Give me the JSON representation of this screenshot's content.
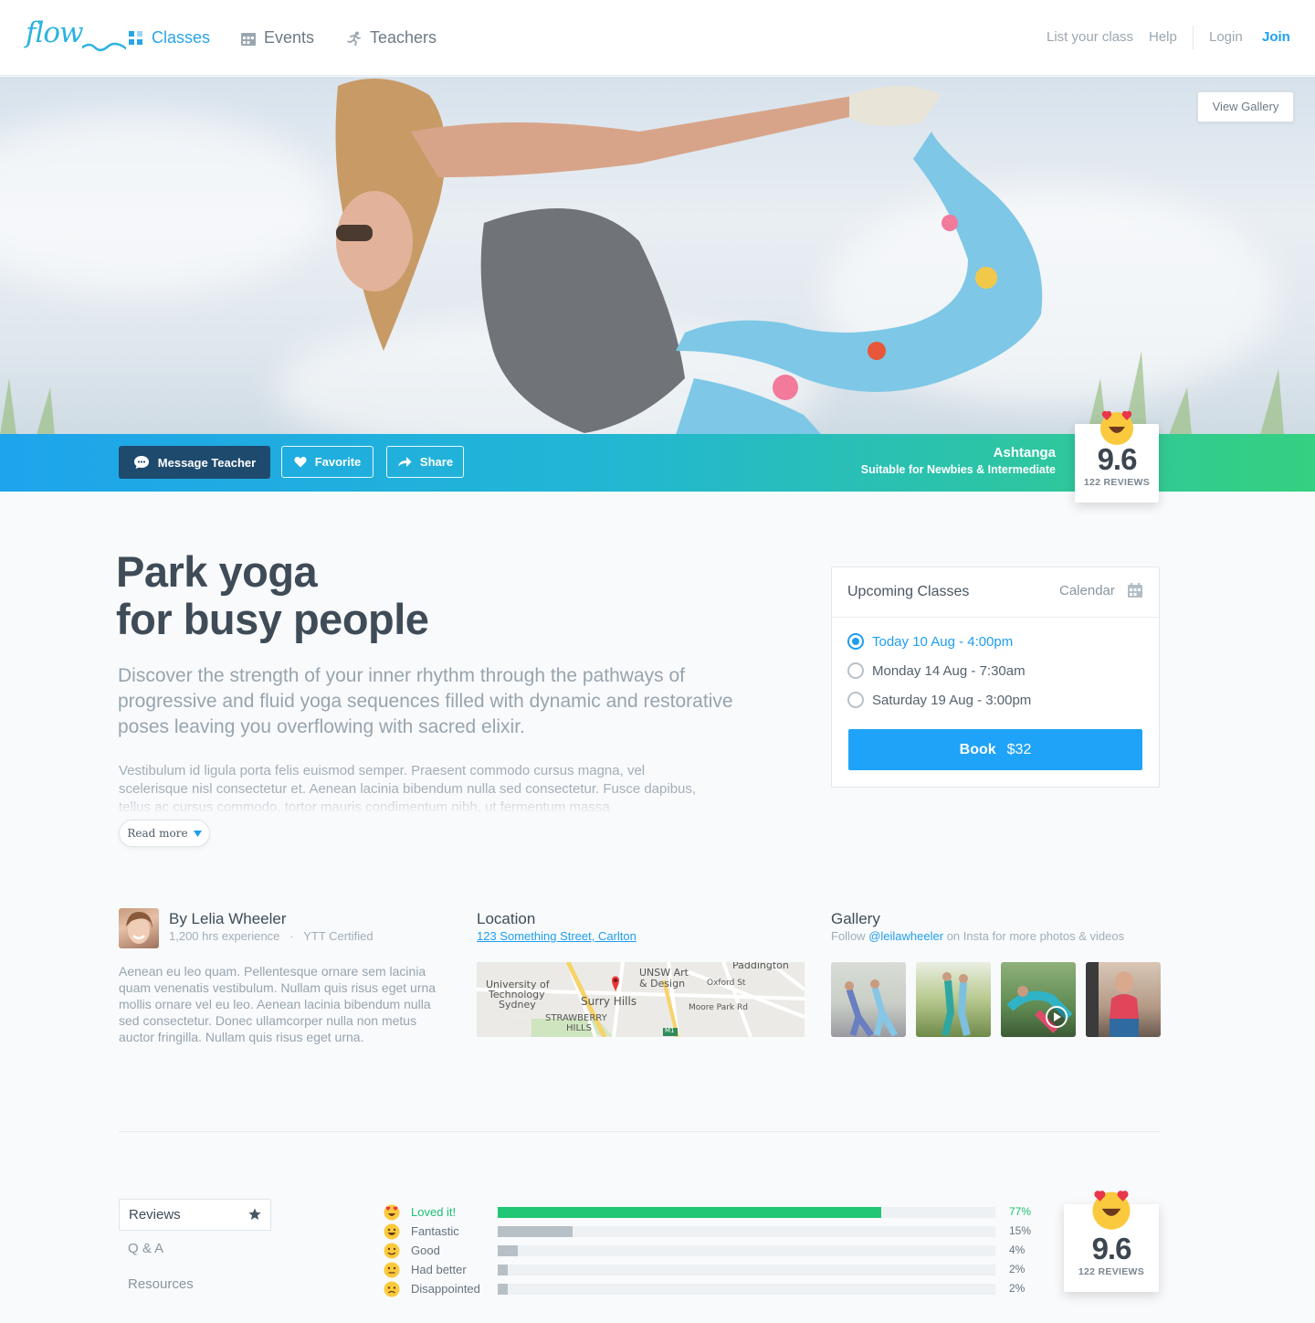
{
  "nav": {
    "logo": "flow",
    "items": [
      {
        "label": "Classes",
        "icon": "grid-icon",
        "active": true
      },
      {
        "label": "Events",
        "icon": "calendar-icon",
        "active": false
      },
      {
        "label": "Teachers",
        "icon": "runner-icon",
        "active": false
      }
    ],
    "right": {
      "list_class": "List your class",
      "help": "Help",
      "login": "Login",
      "join": "Join"
    }
  },
  "hero": {
    "view_gallery": "View Gallery"
  },
  "actions": {
    "message": "Message Teacher",
    "favorite": "Favorite",
    "share": "Share",
    "style": "Ashtanga",
    "level": "Suitable for Newbies & Intermediate"
  },
  "score": {
    "value": "9.6",
    "reviews": "122 REVIEWS"
  },
  "class": {
    "title_line1": "Park yoga",
    "title_line2": "for busy people",
    "lead": "Discover the strength of your inner rhythm through the pathways of progressive and fluid yoga sequences filled with dynamic and restorative poses leaving you overflowing with sacred elixir.",
    "body": "Vestibulum id ligula porta felis euismod semper. Praesent commodo cursus magna, vel scelerisque nisl consectetur et. Aenean lacinia bibendum nulla sed consectetur. Fusce dapibus, tellus ac cursus commodo, tortor mauris condimentum nibh, ut fermentum massa",
    "read_more": "Read more"
  },
  "upcoming": {
    "title": "Upcoming Classes",
    "calendar": "Calendar",
    "slots": [
      {
        "label": "Today 10 Aug - 4:00pm",
        "selected": true
      },
      {
        "label": "Monday 14 Aug - 7:30am",
        "selected": false
      },
      {
        "label": "Saturday 19 Aug - 3:00pm",
        "selected": false
      }
    ],
    "book_label": "Book",
    "book_price": "$32"
  },
  "teacher": {
    "name": "By Lelia Wheeler",
    "experience": "1,200 hrs experience",
    "dot": "·",
    "cert": "YTT Certified",
    "bio": "Aenean eu leo quam. Pellentesque ornare sem lacinia quam venenatis vestibulum. Nullam quis risus eget urna mollis ornare vel eu leo. Aenean lacinia bibendum nulla sed consectetur. Donec ullamcorper nulla non metus auctor fringilla. Nullam quis risus eget urna."
  },
  "location": {
    "title": "Location",
    "address": "123 Something Street, Carlton",
    "map_labels": {
      "paddington": "Paddington",
      "unsw": "UNSW Art",
      "design": "& Design",
      "uts1": "University of",
      "uts2": "Technology",
      "uts3": "Sydney",
      "surry": "Surry Hills",
      "straw1": "STRAWBERRY",
      "straw2": "HILLS",
      "oxford": "Oxford St",
      "moore": "Moore Park Rd",
      "m1": "M1"
    }
  },
  "gallery": {
    "title": "Gallery",
    "follow_pre": "Follow",
    "handle": "@leilawheeler",
    "follow_post": "on Insta for more photos & videos"
  },
  "reviews": {
    "tabs": [
      "Reviews",
      "Q & A",
      "Resources"
    ],
    "rows": [
      {
        "label": "Loved it!",
        "pct_text": "77%",
        "pct": 77
      },
      {
        "label": "Fantastic",
        "pct_text": "15%",
        "pct": 15
      },
      {
        "label": "Good",
        "pct_text": "4%",
        "pct": 4
      },
      {
        "label": "Had better",
        "pct_text": "2%",
        "pct": 2
      },
      {
        "label": "Disappointed",
        "pct_text": "2%",
        "pct": 2
      }
    ]
  },
  "colors": {
    "accent": "#1f9ef0",
    "success": "#20c774",
    "navy": "#1e4a6e"
  }
}
